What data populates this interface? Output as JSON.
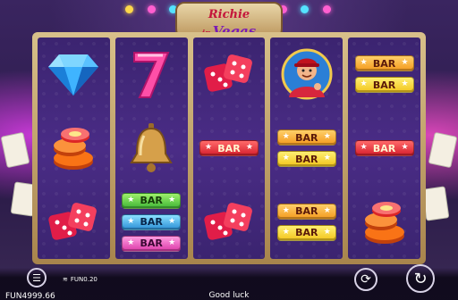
{
  "game": {
    "logo_line1": "Richie",
    "logo_line2_prefix": "in",
    "logo_line2": "Vegas"
  },
  "reels": [
    {
      "symbols": [
        "diamond",
        "chips",
        "dice"
      ]
    },
    {
      "symbols": [
        "seven",
        "bell",
        "bar-stack-green-blue-pink"
      ]
    },
    {
      "symbols": [
        "dice",
        "bar-red",
        "dice"
      ]
    },
    {
      "symbols": [
        "richie",
        "bar-stack-orange-yellow",
        "bar-stack-orange-yellow"
      ]
    },
    {
      "symbols": [
        "bar-stack-orange-yellow",
        "bar-red",
        "chips"
      ]
    }
  ],
  "bar_label": "BAR",
  "status": {
    "balance": "FUN4999.66",
    "bet": "FUN0.20",
    "message": "Good luck"
  },
  "icons": {
    "menu": "menu-icon",
    "bet": "coins-icon",
    "autoplay": "autoplay-icon",
    "spin": "spin-icon"
  },
  "colors": {
    "reel_bg": "#4a2c86",
    "frame": "#c9a66a"
  }
}
